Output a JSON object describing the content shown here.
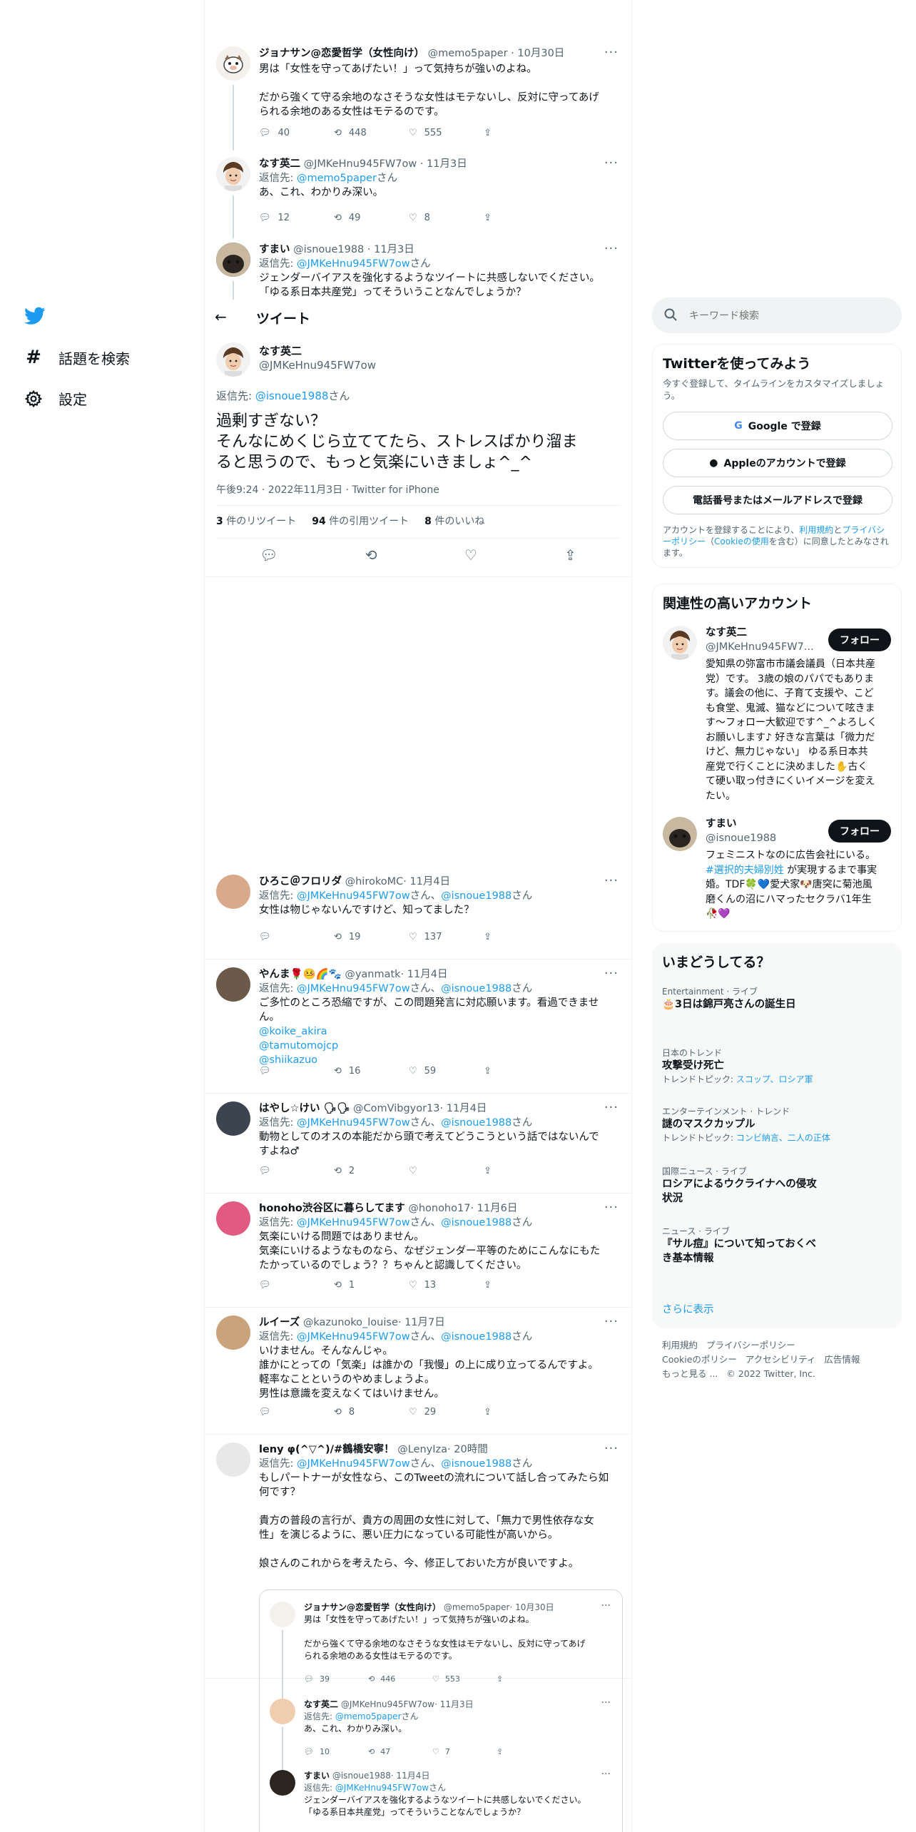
{
  "nav": {
    "explore": "話題を検索",
    "settings": "設定"
  },
  "header": {
    "title": "ツイート"
  },
  "top_tweets": [
    {
      "name": "ジョナサン@恋愛哲学（女性向け）",
      "handle": "@memo5paper",
      "time": "· 10月30日",
      "text": [
        "男は「女性を守ってあげたい！」って気持ちが強いのよね。",
        "",
        "だから強くて守る余地のなさそうな女性はモテないし、反対に守ってあげ",
        "られる余地のある女性はモテるのです。"
      ],
      "replies": "40",
      "retweets": "448",
      "likes": "555"
    },
    {
      "name": "なす英二",
      "handle": "@JMKeHnu945FW7ow",
      "time": "· 11月3日",
      "reply_prefix": "返信先: ",
      "reply_to": "@memo5paper",
      "reply_suffix": "さん",
      "text": [
        "あ、これ、わかりみ深い。"
      ],
      "replies": "12",
      "retweets": "49",
      "likes": "8"
    },
    {
      "name": "すまい",
      "handle": "@isnoue1988",
      "time": "· 11月3日",
      "reply_prefix": "返信先: ",
      "reply_to": "@JMKeHnu945FW7ow",
      "reply_suffix": "さん",
      "text": [
        "ジェンダーバイアスを強化するようなツイートに共感しないでください。",
        "「ゆる系日本共産党」ってそういうことなんでしょうか？"
      ]
    }
  ],
  "main_tweet": {
    "name": "なす英二",
    "handle": "@JMKeHnu945FW7ow",
    "reply_prefix": "返信先: ",
    "reply_to": "@isnoue1988",
    "reply_suffix": "さん",
    "text": [
      "過剰すぎない？",
      "そんなにめくじら立ててたら、ストレスばかり溜ま",
      "ると思うので、もっと気楽にいきましょ^_^"
    ],
    "timestamp": "午後9:24 · 2022年11月3日 · Twitter for iPhone",
    "retweets": "3",
    "retweets_label": " 件のリツイート",
    "quotes": "94",
    "quotes_label": " 件の引用ツイート",
    "likes": "8",
    "likes_label": " 件のいいね"
  },
  "replies": [
    {
      "name": "ひろこ＠フロリダ",
      "handle": "@hirokoMC",
      "time": "· 11月4日",
      "reply_prefix": "返信先: ",
      "reply_to1": "@JMKeHnu945FW7ow",
      "mid": "さん、",
      "reply_to2": "@isnoue1988",
      "reply_suffix": "さん",
      "text": [
        "女性は物じゃないんですけど、知ってました？"
      ],
      "links": [],
      "replies": "",
      "retweets": "19",
      "likes": "137"
    },
    {
      "name": "やんま🌹🤒🌈🐾",
      "handle": "@yanmatk",
      "time": "· 11月4日",
      "reply_prefix": "返信先: ",
      "reply_to1": "@JMKeHnu945FW7ow",
      "mid": "さん、",
      "reply_to2": "@isnoue1988",
      "reply_suffix": "さん",
      "text": [
        "ご多忙のところ恐縮ですが、この問題発言に対応願います。看過できませ",
        "ん。"
      ],
      "links": [
        "@koike_akira",
        "@tamutomojcp",
        "@shiikazuo"
      ],
      "replies": "",
      "retweets": "16",
      "likes": "59"
    },
    {
      "name": "はやし☆けい 🗣🗣",
      "handle": "@ComVibgyor13",
      "time": "· 11月4日",
      "reply_prefix": "返信先: ",
      "reply_to1": "@JMKeHnu945FW7ow",
      "mid": "さん、",
      "reply_to2": "@isnoue1988",
      "reply_suffix": "さん",
      "text": [
        "動物としてのオスの本能だから頭で考えてどうこうという話ではないんで",
        "すよね♂"
      ],
      "links": [],
      "replies": "",
      "retweets": "2",
      "likes": ""
    },
    {
      "name": "honoho渋谷区に暮らしてます",
      "handle": "@honoho17",
      "time": "· 11月6日",
      "reply_prefix": "返信先: ",
      "reply_to1": "@JMKeHnu945FW7ow",
      "mid": "さん、",
      "reply_to2": "@isnoue1988",
      "reply_suffix": "さん",
      "text": [
        "気楽にいける問題ではありません。",
        "気楽にいけるようなものなら、なぜジェンダー平等のためにこんなにもた",
        "たかっているのでしょう？？ちゃんと認識してください。"
      ],
      "links": [],
      "replies": "",
      "retweets": "1",
      "likes": "13"
    },
    {
      "name": "ルイーズ",
      "handle": "@kazunoko_louise",
      "time": "· 11月7日",
      "reply_prefix": "返信先: ",
      "reply_to1": "@JMKeHnu945FW7ow",
      "mid": "さん、",
      "reply_to2": "@isnoue1988",
      "reply_suffix": "さん",
      "text": [
        "いけません。そんなんじゃ。",
        "誰かにとっての「気楽」は誰かの「我慢」の上に成り立ってるんですよ。",
        "軽率なことというのやめましょうよ。",
        "男性は意識を変えなくてはいけません。"
      ],
      "links": [],
      "replies": "",
      "retweets": "8",
      "likes": "29"
    },
    {
      "name": "leny φ(^▽^)/#鶴橋安寧！",
      "handle": "@LenyIza",
      "time": "· 20時間",
      "reply_prefix": "返信先: ",
      "reply_to1": "@JMKeHnu945FW7ow",
      "mid": "さん、",
      "reply_to2": "@isnoue1988",
      "reply_suffix": "さん",
      "text": [
        "もしパートナーが女性なら、このTweetの流れについて話し合ってみたら如",
        "何です？",
        "",
        "貴方の普段の言行が、貴方の周囲の女性に対して、「無力で男性依存な女",
        "性」を演じるように、悪い圧力になっている可能性が高いから。",
        "",
        "娘さんのこれからを考えたら、今、修正しておいた方が良いですよ。"
      ],
      "links": []
    }
  ],
  "quoted": [
    {
      "name": "ジョナサン@恋愛哲学（女性向け）",
      "handle": "@memo5paper",
      "time": "· 10月30日",
      "text": [
        "男は「女性を守ってあげたい！」って気持ちが強いのよね。",
        "",
        "だから強くて守る余地のなさそうな女性はモテないし、反対に守ってあげ",
        "られる余地のある女性はモテるのです。"
      ],
      "replies": "39",
      "retweets": "446",
      "likes": "553"
    },
    {
      "name": "なす英二",
      "handle": "@JMKeHnu945FW7ow",
      "time": "· 11月3日",
      "reply_prefix": "返信先: ",
      "reply_to": "@memo5paper",
      "reply_suffix": "さん",
      "text": [
        "あ、これ、わかりみ深い。"
      ],
      "replies": "10",
      "retweets": "47",
      "likes": "7"
    },
    {
      "name": "すまい",
      "handle": "@isnoue1988",
      "time": "· 11月4日",
      "reply_prefix": "返信先: ",
      "reply_to": "@JMKeHnu945FW7ow",
      "reply_suffix": "さん",
      "text": [
        "ジェンダーバイアスを強化するようなツイートに共感しないでください。",
        "「ゆる系日本共産党」ってそういうことなんでしょうか？"
      ]
    }
  ],
  "search": {
    "placeholder": "キーワード検索"
  },
  "signup": {
    "title": "Twitterを使ってみよう",
    "subtitle": "今すぐ登録して、タイムラインをカスタマイズしましょう。",
    "google": "Google で登録",
    "apple": "Appleのアカウントで登録",
    "phone": "電話番号またはメールアドレスで登録",
    "terms_pre": "アカウントを登録することにより、",
    "terms_link1": "利用規約",
    "terms_mid1": "と",
    "terms_link2": "プライバシーポリシー",
    "terms_mid2": "（",
    "terms_link3": "Cookieの使用",
    "terms_post": "を含む）に同意したとみなされます。"
  },
  "related": {
    "title": "関連性の高いアカウント",
    "follow": "フォロー",
    "accounts": [
      {
        "name": "なす英二",
        "handle": "@JMKeHnu945FW7...",
        "bio": [
          "愛知県の弥富市市議会議員（日本共産",
          "党）です。 3歳の娘のパパでもありま",
          "す。議会の他に、子育て支援や、こど",
          "も食堂、鬼滅、猫などについて呟きま",
          "す〜フォロー大歓迎です^_^よろしく",
          "お願いします♪ 好きな言葉は「微力だ",
          "けど、無力じゃない」 ゆる系日本共",
          "産党で行くことに決めました✋古く",
          "て硬い取っ付きにくいイメージを変え",
          "たい。"
        ]
      },
      {
        "name": "すまい",
        "handle": "@isnoue1988",
        "bio_pre": [
          "フェミニストなのに広告会社にいる。"
        ],
        "bio_link": "#選択的夫婦別姓",
        "bio_after_link": " が実現するまで事実",
        "bio_post": [
          "婚。TDF🍀💙愛犬家🐶唐突に菊池風",
          "磨くんの沼にハマったセクラバ1年生",
          "🥀💜"
        ]
      }
    ]
  },
  "trends": {
    "title": "いまどうしてる？",
    "items": [
      {
        "category": "Entertainment · ライブ",
        "topic": "🎂3日は錦戸亮さんの誕生日",
        "topic2": "",
        "extra_pre": "",
        "extra_links": ""
      },
      {
        "category": "日本のトレンド",
        "topic": "攻撃受け死亡",
        "topic2": "",
        "extra_pre": "トレンドトピック: ",
        "extra_links": "スコップ、ロシア軍"
      },
      {
        "category": "エンターテインメント · トレンド",
        "topic": "謎のマスクカップル",
        "topic2": "",
        "extra_pre": "トレンドトピック: ",
        "extra_links": "コンビ納言、二人の正体"
      },
      {
        "category": "国際ニュース · ライブ",
        "topic": "ロシアによるウクライナへの侵攻",
        "topic2": "状況",
        "extra_pre": "",
        "extra_links": ""
      },
      {
        "category": "ニュース · ライブ",
        "topic": "『サル痘』について知っておくべ",
        "topic2": "き基本情報",
        "extra_pre": "",
        "extra_links": ""
      }
    ],
    "more": "さらに表示"
  },
  "footer": {
    "line1": [
      "利用規約",
      "プライバシーポリシー"
    ],
    "line2": [
      "Cookieのポリシー",
      "アクセシビリティ",
      "広告情報"
    ],
    "more": "もっと見る ...",
    "copyright": "© 2022 Twitter, Inc."
  },
  "colors": {
    "accent": "#1d9bf0",
    "text": "#0f1419",
    "muted": "#536471",
    "border": "#eff3f4"
  }
}
